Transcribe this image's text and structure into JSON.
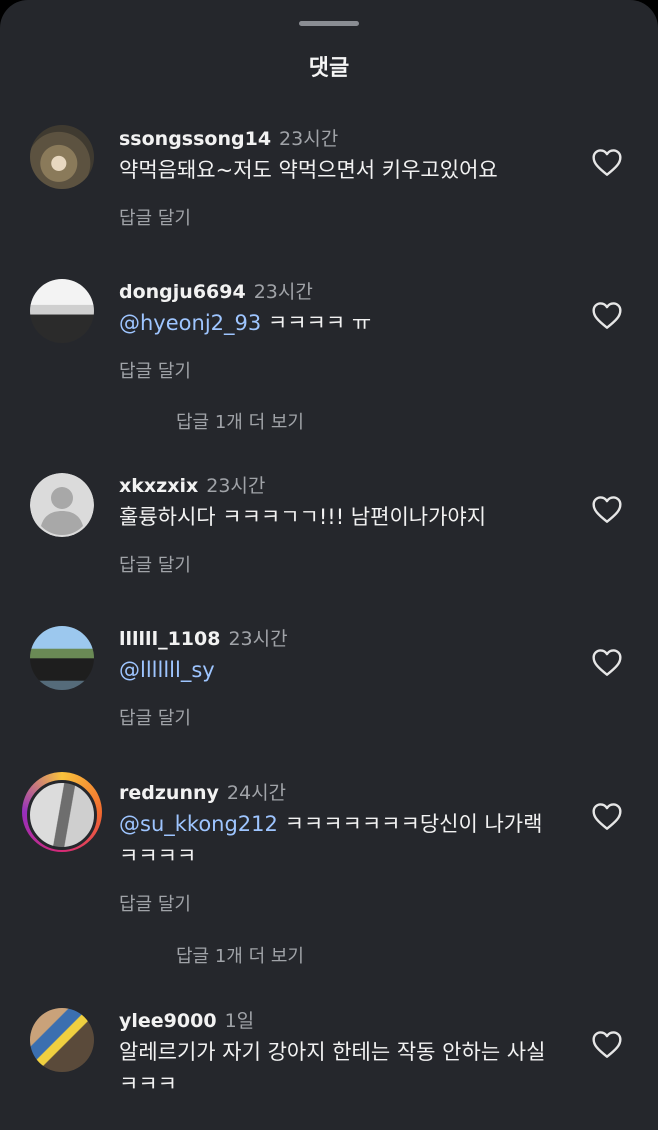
{
  "header": {
    "title": "댓글"
  },
  "comments": [
    {
      "username": "ssongssong14",
      "time": "23시간",
      "mention": "",
      "text": "약먹음돼요~저도 약먹으면서 키우고있어요",
      "reply_label": "답글 달기",
      "more_replies": ""
    },
    {
      "username": "dongju6694",
      "time": "23시간",
      "mention": "@hyeonj2_93",
      "text": " ㅋㅋㅋㅋ ㅠ",
      "reply_label": "답글 달기",
      "more_replies": "답글 1개 더 보기"
    },
    {
      "username": "xkxzxix",
      "time": "23시간",
      "mention": "",
      "text": "훌륭하시다 ㅋㅋㅋㄱㄱ!!! 남편이나가야지",
      "reply_label": "답글 달기",
      "more_replies": ""
    },
    {
      "username": "llllll_1108",
      "time": "23시간",
      "mention": "@lllllll_sy",
      "text": "",
      "reply_label": "답글 달기",
      "more_replies": ""
    },
    {
      "username": "redzunny",
      "time": "24시간",
      "mention": "@su_kkong212",
      "text": " ㅋㅋㅋㅋㅋㅋㅋ당신이 나가랙ㅋㅋㅋㅋ",
      "reply_label": "답글 달기",
      "more_replies": "답글 1개 더 보기"
    },
    {
      "username": "ylee9000",
      "time": "1일",
      "mention": "",
      "text": "알레르기가 자기 강아지 한테는 작동 안하는 사실 ㅋㅋㅋ",
      "reply_label": "",
      "more_replies": ""
    }
  ],
  "colors": {
    "background": "#25272c",
    "mention": "#9ec5ff",
    "muted": "#a0a3a8"
  },
  "icons": {
    "like": "heart-outline-icon",
    "default_avatar": "default-avatar-icon"
  }
}
